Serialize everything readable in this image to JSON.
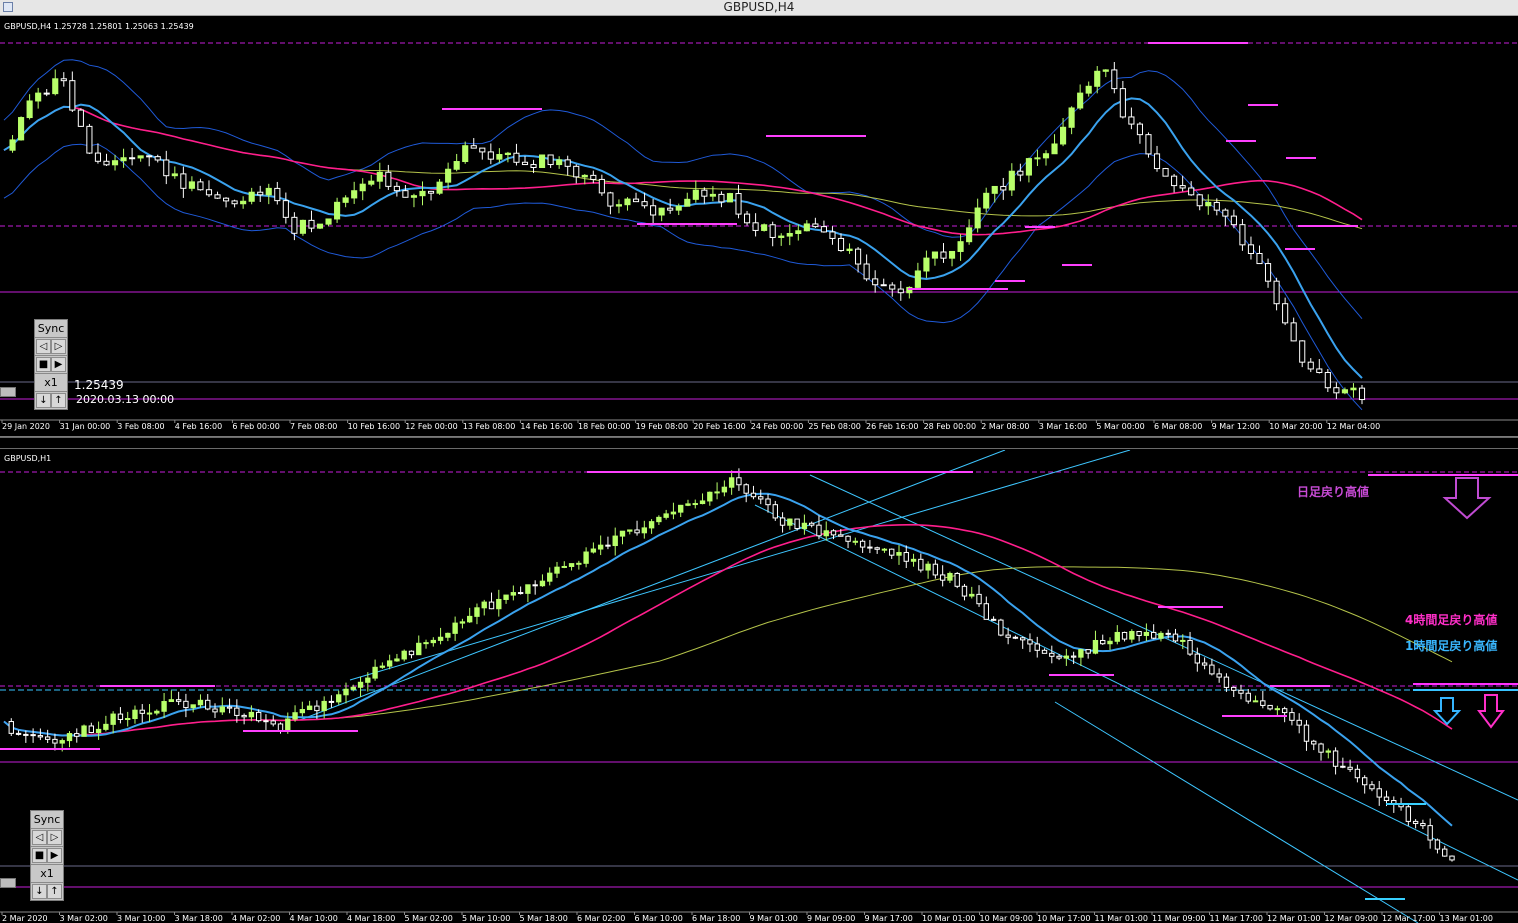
{
  "window": {
    "title": "GBPUSD,H4"
  },
  "colors": {
    "bull": "#b8ff6a",
    "bear": "#ffffff",
    "ma_fast": "#3aa2ee",
    "ma_mid": "#ff1e8c",
    "ma_slow": "#b4c34a",
    "bb": "#1f5ad8",
    "level": "#c41ed8",
    "highline": "#ff40ff",
    "channel": "#3ec6ff"
  },
  "sync_panel": {
    "label": "Sync",
    "speed": "x1",
    "prev": "◁",
    "next": "▷",
    "stop": "■",
    "play": "▶",
    "down": "↓",
    "up": "↑"
  },
  "h4": {
    "header": "GBPUSD,H4  1.25728 1.25801 1.25063 1.25439",
    "readout_price": "1.25439",
    "readout_time": "2020.03.13 00:00"
  },
  "h1": {
    "header": "GBPUSD,H1",
    "ann_daily": "日足戻り高値",
    "ann_h4": "4時間足戻り高値",
    "ann_h1": "1時間足戻り高値"
  },
  "chart_data": [
    {
      "type": "candlestick",
      "symbol": "GBPUSD",
      "timeframe": "H4",
      "ohlc_last": {
        "open": 1.25728,
        "high": 1.25801,
        "low": 1.25063,
        "close": 1.25439
      },
      "x_tick_labels": [
        "29 Jan 2020",
        "31 Jan 00:00",
        "3 Feb 08:00",
        "4 Feb 16:00",
        "6 Feb 00:00",
        "7 Feb 08:00",
        "10 Feb 16:00",
        "12 Feb 00:00",
        "13 Feb 08:00",
        "14 Feb 16:00",
        "18 Feb 00:00",
        "19 Feb 08:00",
        "20 Feb 16:00",
        "24 Feb 00:00",
        "25 Feb 08:00",
        "26 Feb 16:00",
        "28 Feb 00:00",
        "2 Mar 08:00",
        "3 Mar 16:00",
        "5 Mar 00:00",
        "6 Mar 08:00",
        "9 Mar 12:00",
        "10 Mar 20:00",
        "12 Mar 04:00"
      ],
      "close_path": [
        0.74,
        0.88,
        0.95,
        0.72,
        0.7,
        0.72,
        0.64,
        0.6,
        0.58,
        0.62,
        0.5,
        0.52,
        0.62,
        0.66,
        0.6,
        0.62,
        0.74,
        0.72,
        0.7,
        0.7,
        0.66,
        0.58,
        0.56,
        0.56,
        0.6,
        0.6,
        0.5,
        0.48,
        0.52,
        0.45,
        0.34,
        0.3,
        0.4,
        0.46,
        0.6,
        0.66,
        0.72,
        0.86,
        0.98,
        0.8,
        0.68,
        0.6,
        0.56,
        0.45,
        0.3,
        0.1,
        0.02,
        0.0
      ],
      "series": [
        {
          "name": "MA fast"
        },
        {
          "name": "MA mid"
        },
        {
          "name": "MA slow"
        },
        {
          "name": "Bollinger Bands"
        }
      ]
    },
    {
      "type": "candlestick",
      "symbol": "GBPUSD",
      "timeframe": "H1",
      "x_tick_labels": [
        "2 Mar 2020",
        "3 Mar 02:00",
        "3 Mar 10:00",
        "3 Mar 18:00",
        "4 Mar 02:00",
        "4 Mar 10:00",
        "4 Mar 18:00",
        "5 Mar 02:00",
        "5 Mar 10:00",
        "5 Mar 18:00",
        "6 Mar 02:00",
        "6 Mar 10:00",
        "6 Mar 18:00",
        "9 Mar 01:00",
        "9 Mar 09:00",
        "9 Mar 17:00",
        "10 Mar 01:00",
        "10 Mar 09:00",
        "10 Mar 17:00",
        "11 Mar 01:00",
        "11 Mar 09:00",
        "11 Mar 17:00",
        "12 Mar 01:00",
        "12 Mar 09:00",
        "12 Mar 17:00",
        "13 Mar 01:00"
      ],
      "close_path": [
        0.4,
        0.36,
        0.42,
        0.46,
        0.44,
        0.4,
        0.48,
        0.56,
        0.64,
        0.72,
        0.78,
        0.86,
        0.92,
        1.0,
        0.9,
        0.86,
        0.82,
        0.76,
        0.62,
        0.56,
        0.62,
        0.62,
        0.48,
        0.42,
        0.3,
        0.2,
        0.08
      ],
      "series": [
        {
          "name": "MA fast"
        },
        {
          "name": "MA mid"
        },
        {
          "name": "MA slow"
        }
      ]
    }
  ]
}
